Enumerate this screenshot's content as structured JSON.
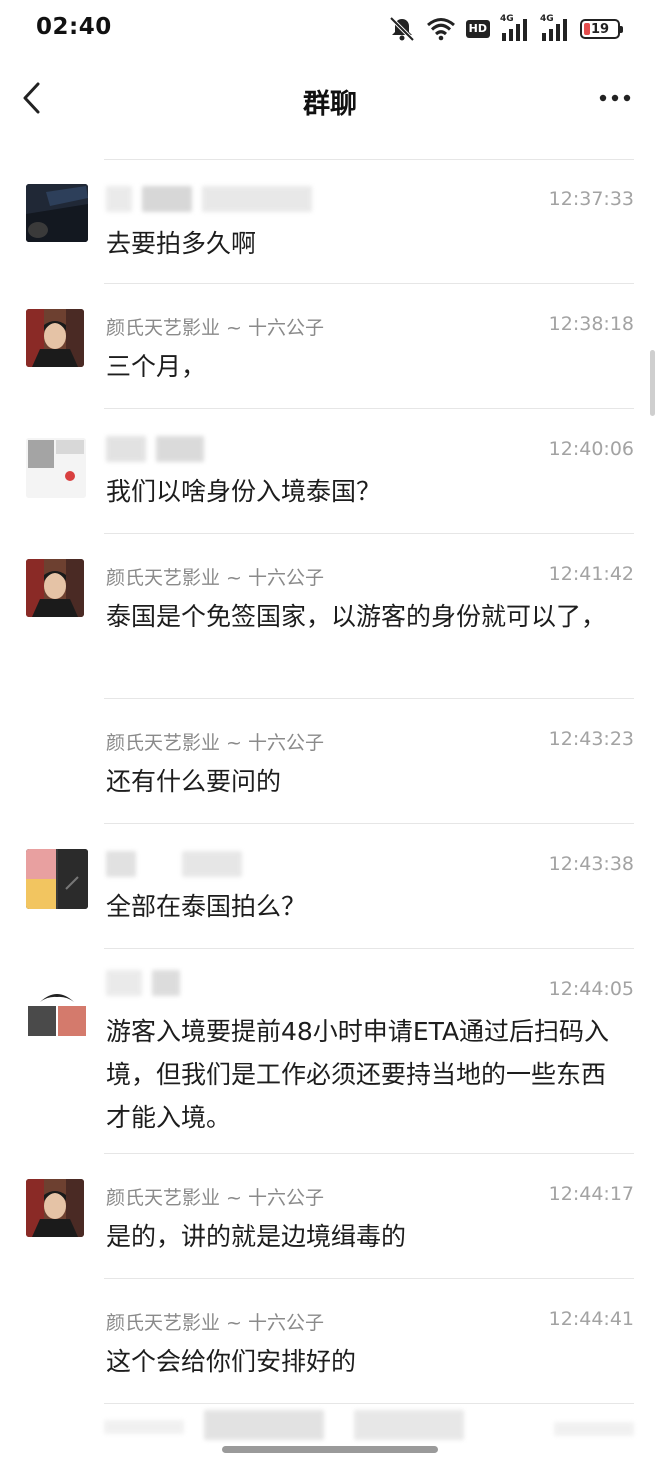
{
  "status_bar": {
    "time": "02:40",
    "hd_label": "HD",
    "network_1": "4G",
    "network_2": "4G",
    "battery": "19",
    "battery_level": 0.19,
    "battery_color": "#e54d4d",
    "icons": [
      "mute-bell-icon",
      "wifi-icon",
      "hd-icon",
      "signal-icon",
      "signal-icon",
      "battery-icon"
    ]
  },
  "nav": {
    "title": "群聊",
    "back_icon": "chevron-left-icon",
    "more_icon": "more-dots-icon"
  },
  "messages": [
    {
      "sender": "",
      "time": "12:37:33",
      "text": "去要拍多久啊",
      "avatar": "avatar-dark-photo",
      "blurred": true
    },
    {
      "sender": "颜氏天艺影业 ~ 十六公子",
      "time": "12:38:18",
      "text": "三个月，",
      "avatar": "avatar-man-photo",
      "blurred": false
    },
    {
      "sender": "",
      "time": "12:40:06",
      "text": "我们以啥身份入境泰国？",
      "avatar": "avatar-grey-blurred",
      "blurred": true
    },
    {
      "sender": "颜氏天艺影业 ~ 十六公子",
      "time": "12:41:42",
      "text": "泰国是个免签国家，以游客的身份就可以了，",
      "avatar": "avatar-man-photo",
      "blurred": false
    },
    {
      "sender": "颜氏天艺影业 ~ 十六公子",
      "time": "12:43:23",
      "text": "还有什么要问的",
      "avatar": "",
      "blurred": false
    },
    {
      "sender": "",
      "time": "12:43:38",
      "text": "全部在泰国拍么？",
      "avatar": "avatar-pink-yellow",
      "blurred": true
    },
    {
      "sender": "",
      "time": "12:44:05",
      "text": "游客入境要提前48小时申请ETA通过后扫码入境，但我们是工作必须还要持当地的一些东西才能入境。",
      "avatar": "avatar-red-grey",
      "blurred": true
    },
    {
      "sender": "颜氏天艺影业 ~ 十六公子",
      "time": "12:44:17",
      "text": "是的，讲的就是边境缉毒的",
      "avatar": "avatar-man-photo",
      "blurred": false
    },
    {
      "sender": "颜氏天艺影业 ~ 十六公子",
      "time": "12:44:41",
      "text": "这个会给你们安排好的",
      "avatar": "",
      "blurred": false
    }
  ]
}
